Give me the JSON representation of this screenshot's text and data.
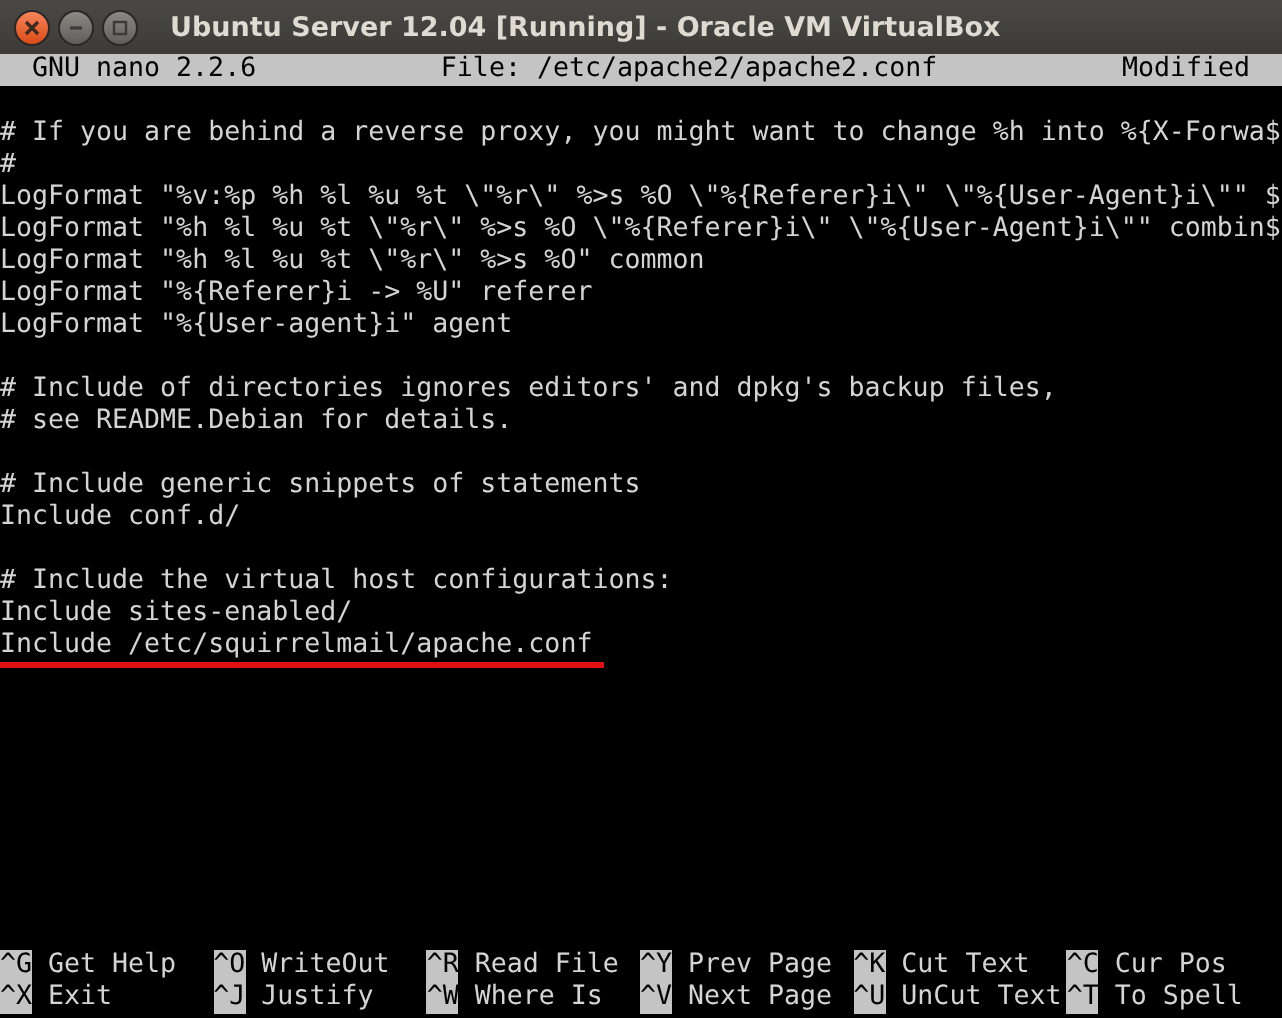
{
  "window": {
    "title": "Ubuntu Server 12.04 [Running] - Oracle VM VirtualBox"
  },
  "header": {
    "program": "GNU nano 2.2.6",
    "file": "File: /etc/apache2/apache2.conf",
    "status": "Modified"
  },
  "blocks": [
    [
      {
        "text": "# If you are behind a reverse proxy, you might want to change %h into %{X-Forwa$",
        "underlined": false
      },
      {
        "text": "#",
        "underlined": false
      },
      {
        "text": "LogFormat \"%v:%p %h %l %u %t \\\"%r\\\" %>s %O \\\"%{Referer}i\\\" \\\"%{User-Agent}i\\\"\" $",
        "underlined": false
      },
      {
        "text": "LogFormat \"%h %l %u %t \\\"%r\\\" %>s %O \\\"%{Referer}i\\\" \\\"%{User-Agent}i\\\"\" combin$",
        "underlined": false
      },
      {
        "text": "LogFormat \"%h %l %u %t \\\"%r\\\" %>s %O\" common",
        "underlined": false
      },
      {
        "text": "LogFormat \"%{Referer}i -> %U\" referer",
        "underlined": false
      },
      {
        "text": "LogFormat \"%{User-agent}i\" agent",
        "underlined": false
      }
    ],
    [
      {
        "text": "# Include of directories ignores editors' and dpkg's backup files,",
        "underlined": false
      },
      {
        "text": "# see README.Debian for details.",
        "underlined": false
      }
    ],
    [
      {
        "text": "# Include generic snippets of statements",
        "underlined": false
      },
      {
        "text": "Include conf.d/",
        "underlined": false
      }
    ],
    [
      {
        "text": "# Include the virtual host configurations:",
        "underlined": false
      },
      {
        "text": "Include sites-enabled/",
        "underlined": false
      },
      {
        "text": "Include /etc/squirrelmail/apache.conf",
        "underlined": true
      }
    ]
  ],
  "shortcuts": [
    {
      "key": "^G",
      "label": "Get Help"
    },
    {
      "key": "^O",
      "label": "WriteOut"
    },
    {
      "key": "^R",
      "label": "Read File"
    },
    {
      "key": "^Y",
      "label": "Prev Page"
    },
    {
      "key": "^K",
      "label": "Cut Text"
    },
    {
      "key": "^C",
      "label": "Cur Pos"
    },
    {
      "key": "^X",
      "label": "Exit"
    },
    {
      "key": "^J",
      "label": "Justify"
    },
    {
      "key": "^W",
      "label": "Where Is"
    },
    {
      "key": "^V",
      "label": "Next Page"
    },
    {
      "key": "^U",
      "label": "UnCut Text"
    },
    {
      "key": "^T",
      "label": "To Spell"
    }
  ]
}
